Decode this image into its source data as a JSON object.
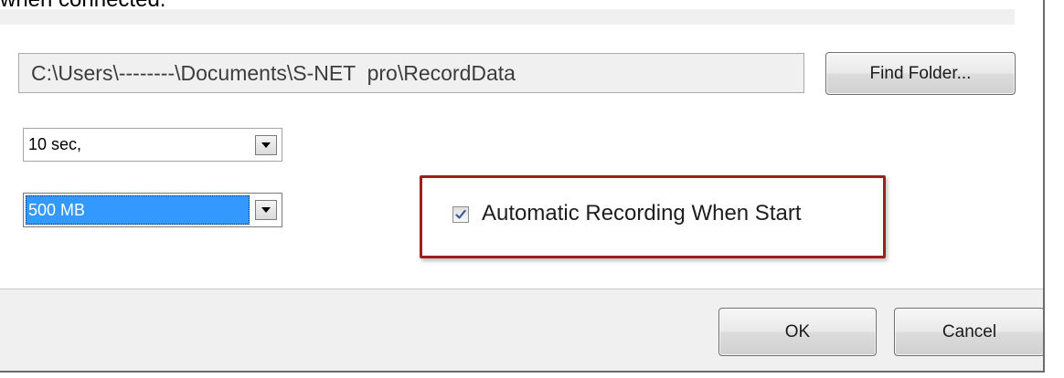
{
  "header": {
    "cutoff_text": "when connected."
  },
  "recording": {
    "folder_path": "C:\\Users\\--------\\Documents\\S-NET  pro\\RecordData",
    "find_folder_label": "Find Folder...",
    "duration_value": "10 sec,",
    "size_value": "500 MB",
    "auto_record_label": "Automatic Recording When Start",
    "auto_record_checked": true
  },
  "footer": {
    "ok_label": "OK",
    "cancel_label": "Cancel"
  },
  "colors": {
    "highlight_border": "#9b2020",
    "selection": "#3399ff",
    "dialog_bg": "#f0f0f0"
  },
  "icons": {
    "dropdown": "chevron-down-icon",
    "checkbox": "check-icon"
  }
}
